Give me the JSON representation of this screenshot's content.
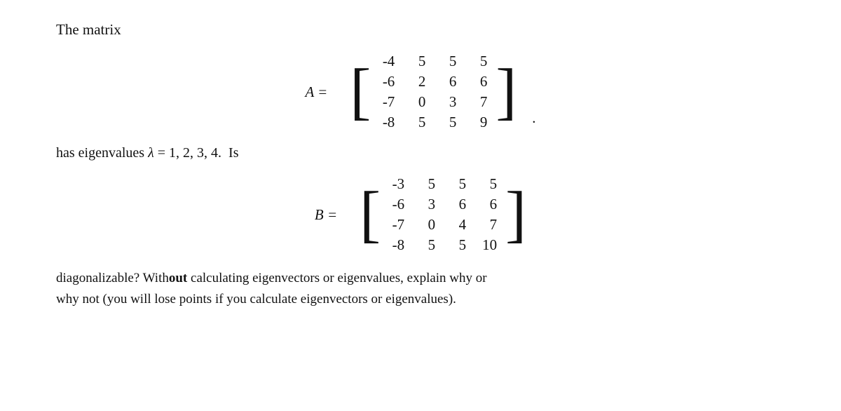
{
  "title": "The matrix",
  "matrixA": {
    "label": "A =",
    "rows": [
      [
        "-4",
        "5",
        "5",
        "5"
      ],
      [
        "-6",
        "2",
        "6",
        "6"
      ],
      [
        "-7",
        "0",
        "3",
        "7"
      ],
      [
        "-8",
        "5",
        "5",
        "9"
      ]
    ],
    "dot": "."
  },
  "eigenvalues_text_before": "has eigenvalues λ = 1, 2, 3, 4.  Is",
  "matrixB": {
    "label": "B =",
    "rows": [
      [
        "-3",
        "5",
        "5",
        "5"
      ],
      [
        "-6",
        "3",
        "6",
        "6"
      ],
      [
        "-7",
        "0",
        "4",
        "7"
      ],
      [
        "-8",
        "5",
        "5",
        "10"
      ]
    ]
  },
  "final_line_1": "diagonalizable? Without",
  "final_line_bold": "out",
  "final_line_2": " calculating eigenvectors or eigenvalues, explain why or",
  "final_line_3": "why not (you will lose points if you calculate eigenvectors or eigenvalues).",
  "diagonalizable_full": "diagonalizable? Without calculating eigenvectors or eigenvalues, explain why or",
  "why_not_line": "why not (you will lose points if you calculate eigenvectors or eigenvalues)."
}
